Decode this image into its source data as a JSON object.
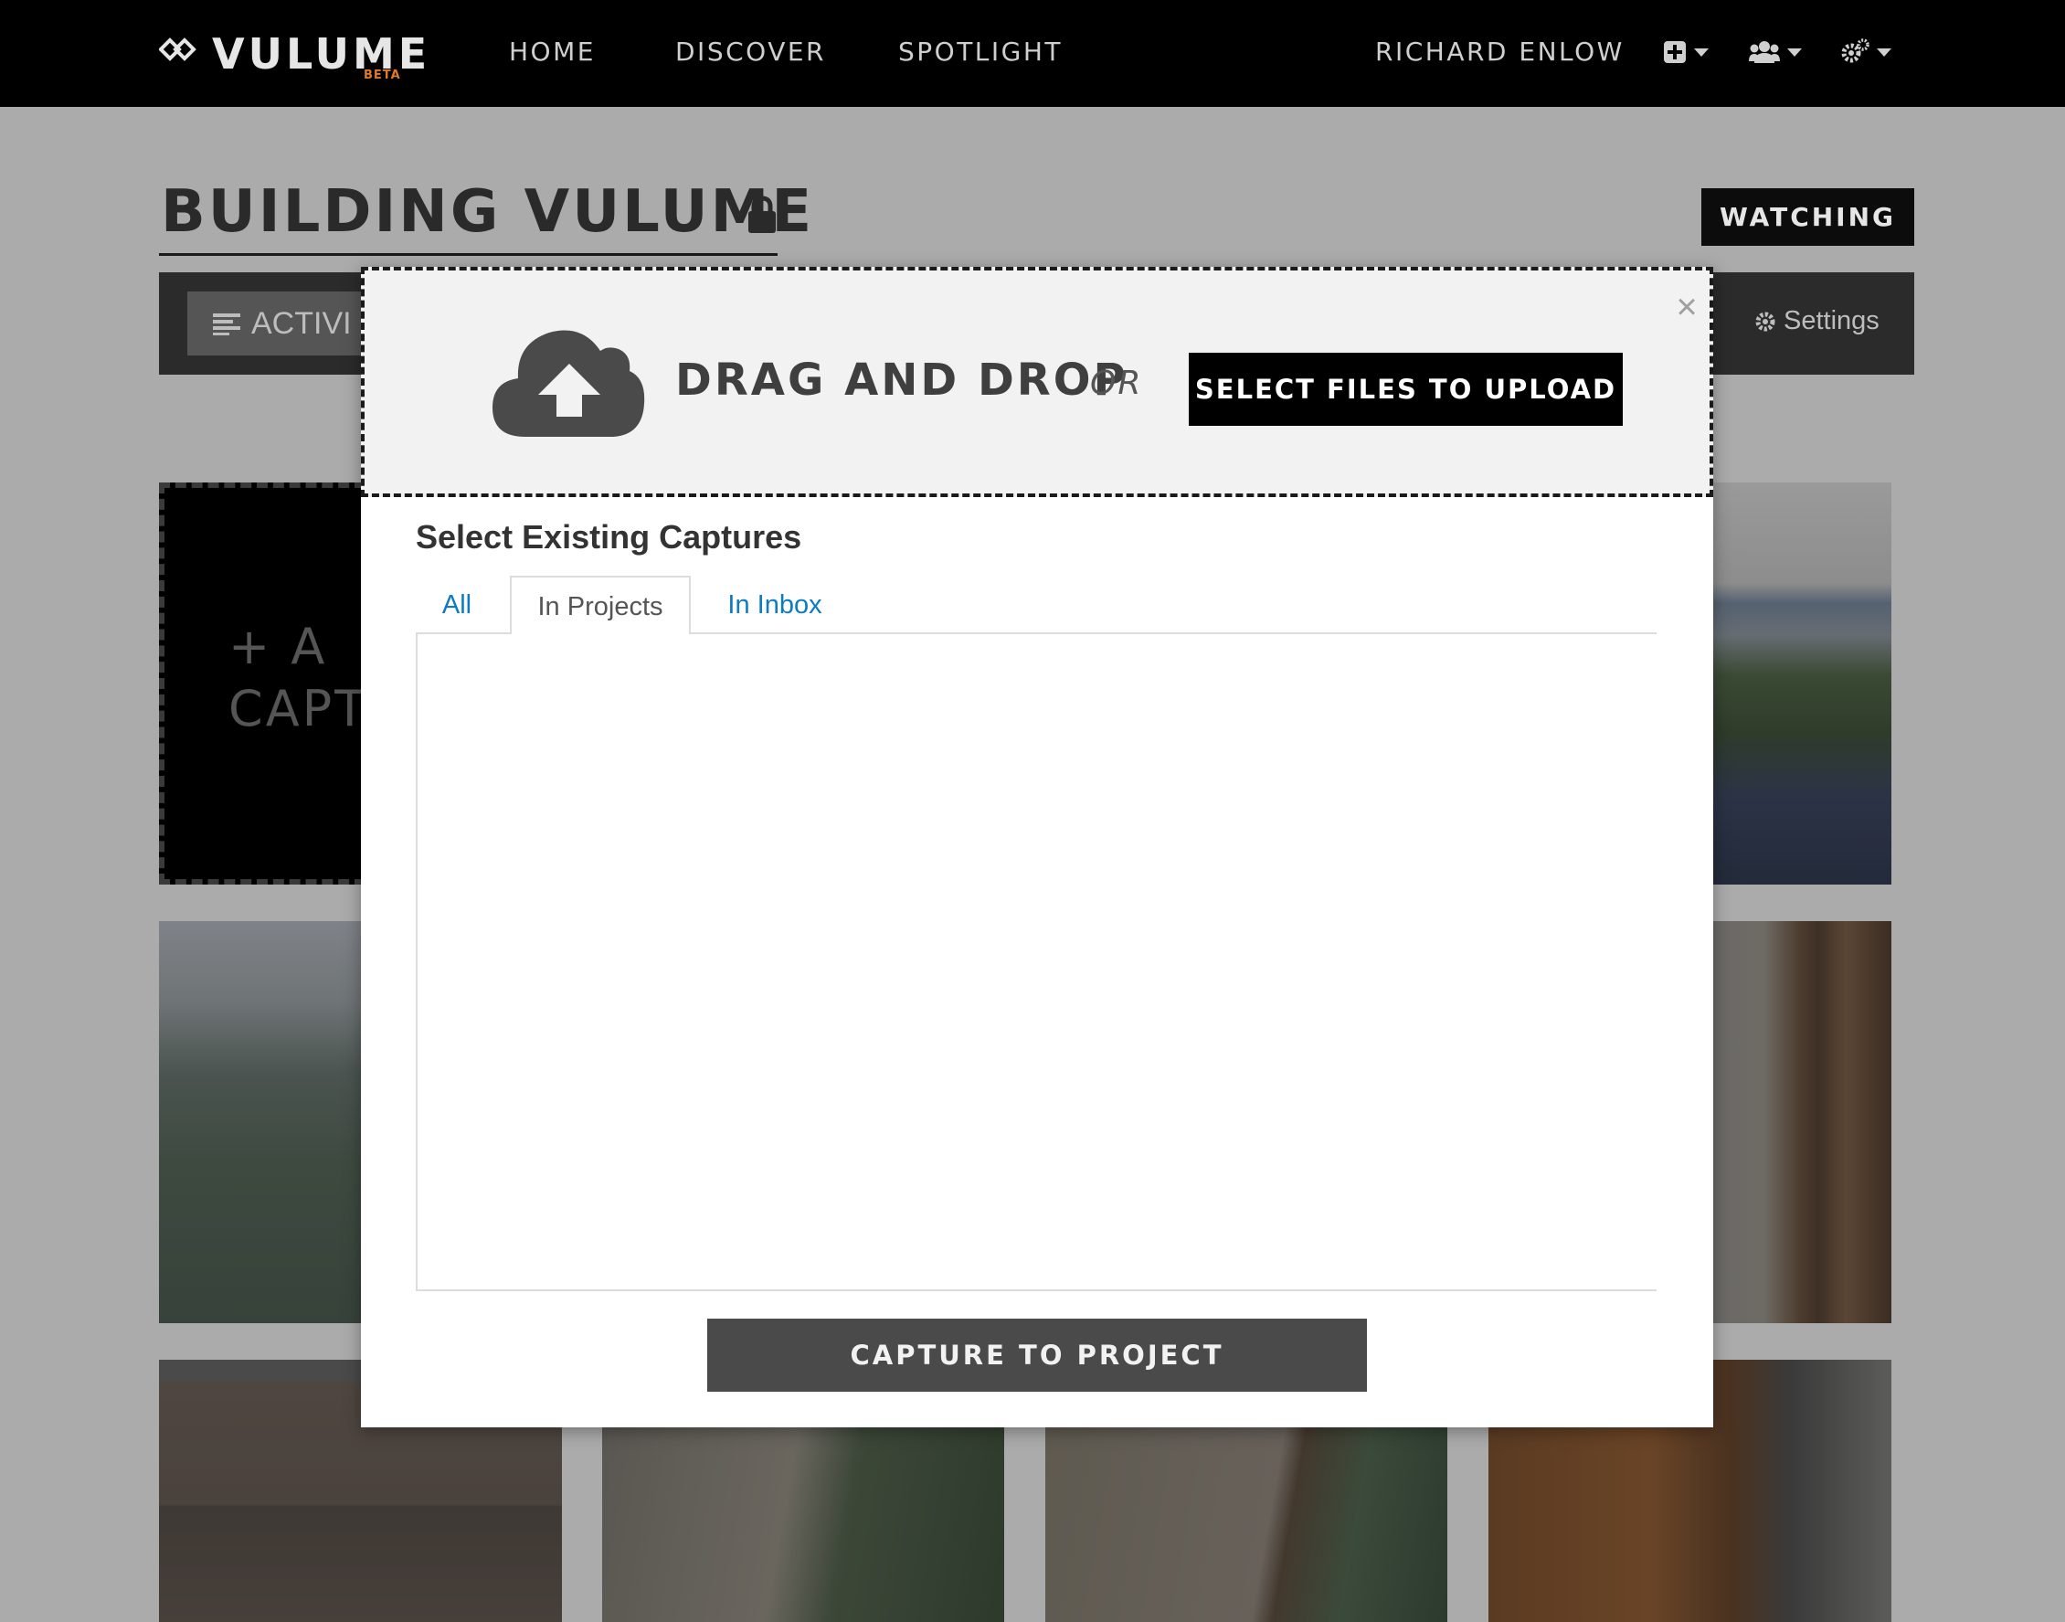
{
  "nav": {
    "logo_text": "VULUME",
    "logo_badge": "BETA",
    "links": [
      {
        "label": "HOME"
      },
      {
        "label": "DISCOVER"
      },
      {
        "label": "SPOTLIGHT"
      }
    ],
    "user_name": "RICHARD ENLOW",
    "icons": [
      "add-icon",
      "users-icon",
      "settings-gears-icon"
    ]
  },
  "project": {
    "title": "BUILDING VULUME",
    "privacy_icon": "lock-icon",
    "watch_button": "WATCHING",
    "activity_button": "ACTIVI",
    "settings_link": "Settings"
  },
  "add_tile": {
    "line1": "+ A",
    "line2": "CAPT"
  },
  "modal": {
    "close_label": "×",
    "drag_text": "DRAG AND DROP",
    "or_text": "OR",
    "upload_button": "SELECT FILES TO UPLOAD",
    "existing_title": "Select Existing Captures",
    "tabs": [
      {
        "label": "All",
        "active": false
      },
      {
        "label": "In Projects",
        "active": true
      },
      {
        "label": "In Inbox",
        "active": false
      }
    ],
    "capture_button": "CAPTURE TO PROJECT"
  },
  "colors": {
    "nav_bg": "#000000",
    "overlay_bg": "#ababab",
    "link_blue": "#0a7bc4",
    "logo_beta": "#e07a2a"
  }
}
